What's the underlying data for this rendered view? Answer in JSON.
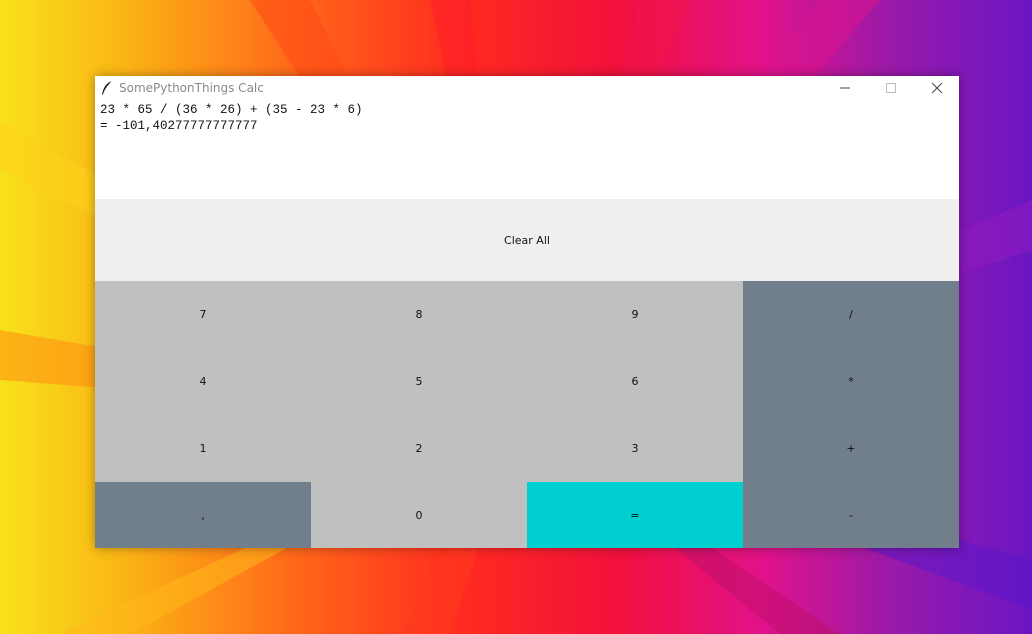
{
  "window": {
    "title": "SomePythonThings Calc",
    "icons": [
      "feather-icon",
      "minimize-icon",
      "maximize-icon",
      "close-icon"
    ]
  },
  "display": {
    "expression": "23 * 65 / (36 * 26) + (35 - 23 * 6)",
    "result": "= -101,40277777777777"
  },
  "buttons": {
    "clear_all": "Clear All",
    "seven": "7",
    "eight": "8",
    "nine": "9",
    "divide": "/",
    "four": "4",
    "five": "5",
    "six": "6",
    "multiply": "*",
    "one": "1",
    "two": "2",
    "three": "3",
    "plus": "+",
    "comma": ",",
    "zero": "0",
    "equals": "=",
    "minus": "-"
  },
  "colors": {
    "number_key": "#c0c0c0",
    "operator_key": "#717e8b",
    "equals_key": "#00cfcf",
    "clear_key": "#efefef"
  }
}
